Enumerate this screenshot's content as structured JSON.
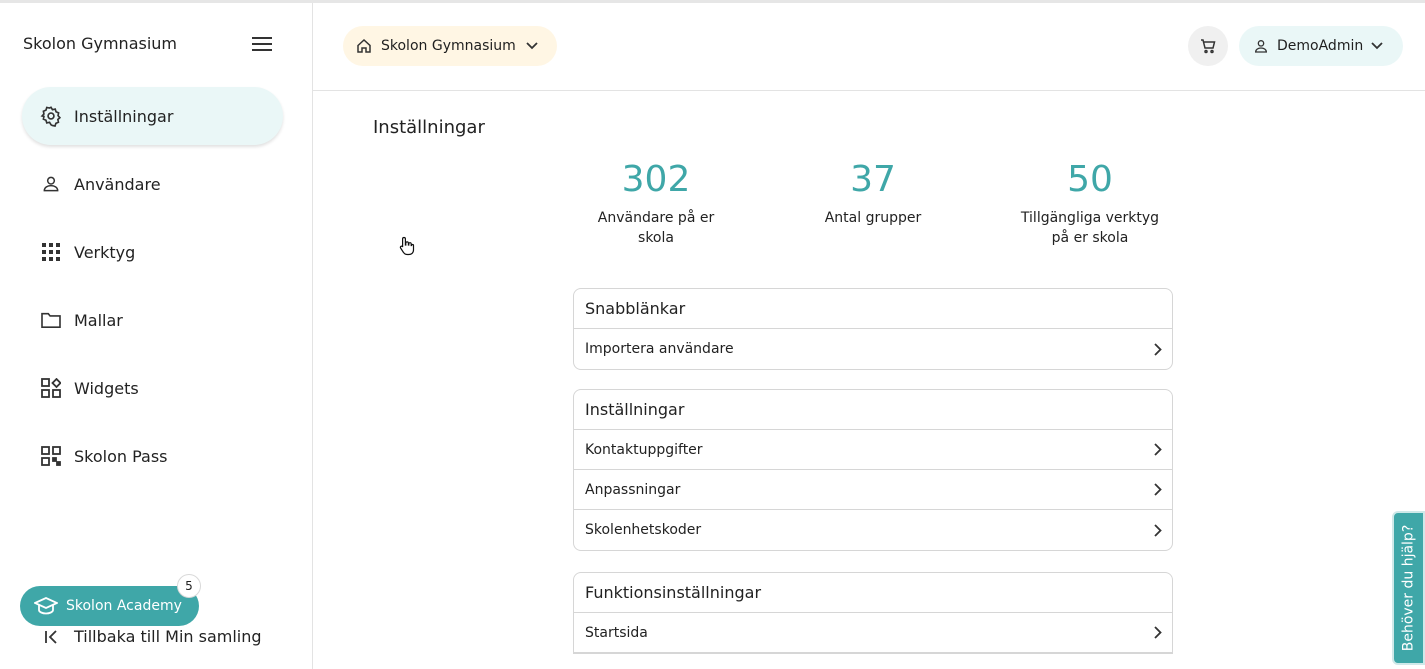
{
  "sidebar": {
    "brand": "Skolon Gymnasium",
    "items": [
      {
        "label": "Inställningar",
        "icon": "gear-icon",
        "active": true
      },
      {
        "label": "Användare",
        "icon": "person-icon"
      },
      {
        "label": "Verktyg",
        "icon": "apps-grid-icon"
      },
      {
        "label": "Mallar",
        "icon": "folder-icon"
      },
      {
        "label": "Widgets",
        "icon": "widgets-icon"
      },
      {
        "label": "Skolon Pass",
        "icon": "qr-code-icon"
      }
    ],
    "academy_label": "Skolon Academy",
    "academy_badge": "5",
    "back_label": "Tillbaka till Min samling"
  },
  "header": {
    "school_select": "Skolon Gymnasium",
    "user": "DemoAdmin"
  },
  "main": {
    "title": "Inställningar",
    "stats": [
      {
        "value": "302",
        "label": "Användare på er skola"
      },
      {
        "value": "37",
        "label": "Antal grupper"
      },
      {
        "value": "50",
        "label": "Tillgängliga verktyg på er skola"
      }
    ],
    "cards": [
      {
        "title": "Snabblänkar",
        "rows": [
          "Importera användare"
        ]
      },
      {
        "title": "Inställningar",
        "rows": [
          "Kontaktuppgifter",
          "Anpassningar",
          "Skolenhetskoder"
        ]
      },
      {
        "title": "Funktionsinställningar",
        "rows": [
          "Startsida"
        ]
      }
    ]
  },
  "help_tab": "Behöver du hjälp?",
  "colors": {
    "accent": "#3fa7a8",
    "active_bg": "#eaf7f7",
    "school_bg": "#fff6e4"
  }
}
